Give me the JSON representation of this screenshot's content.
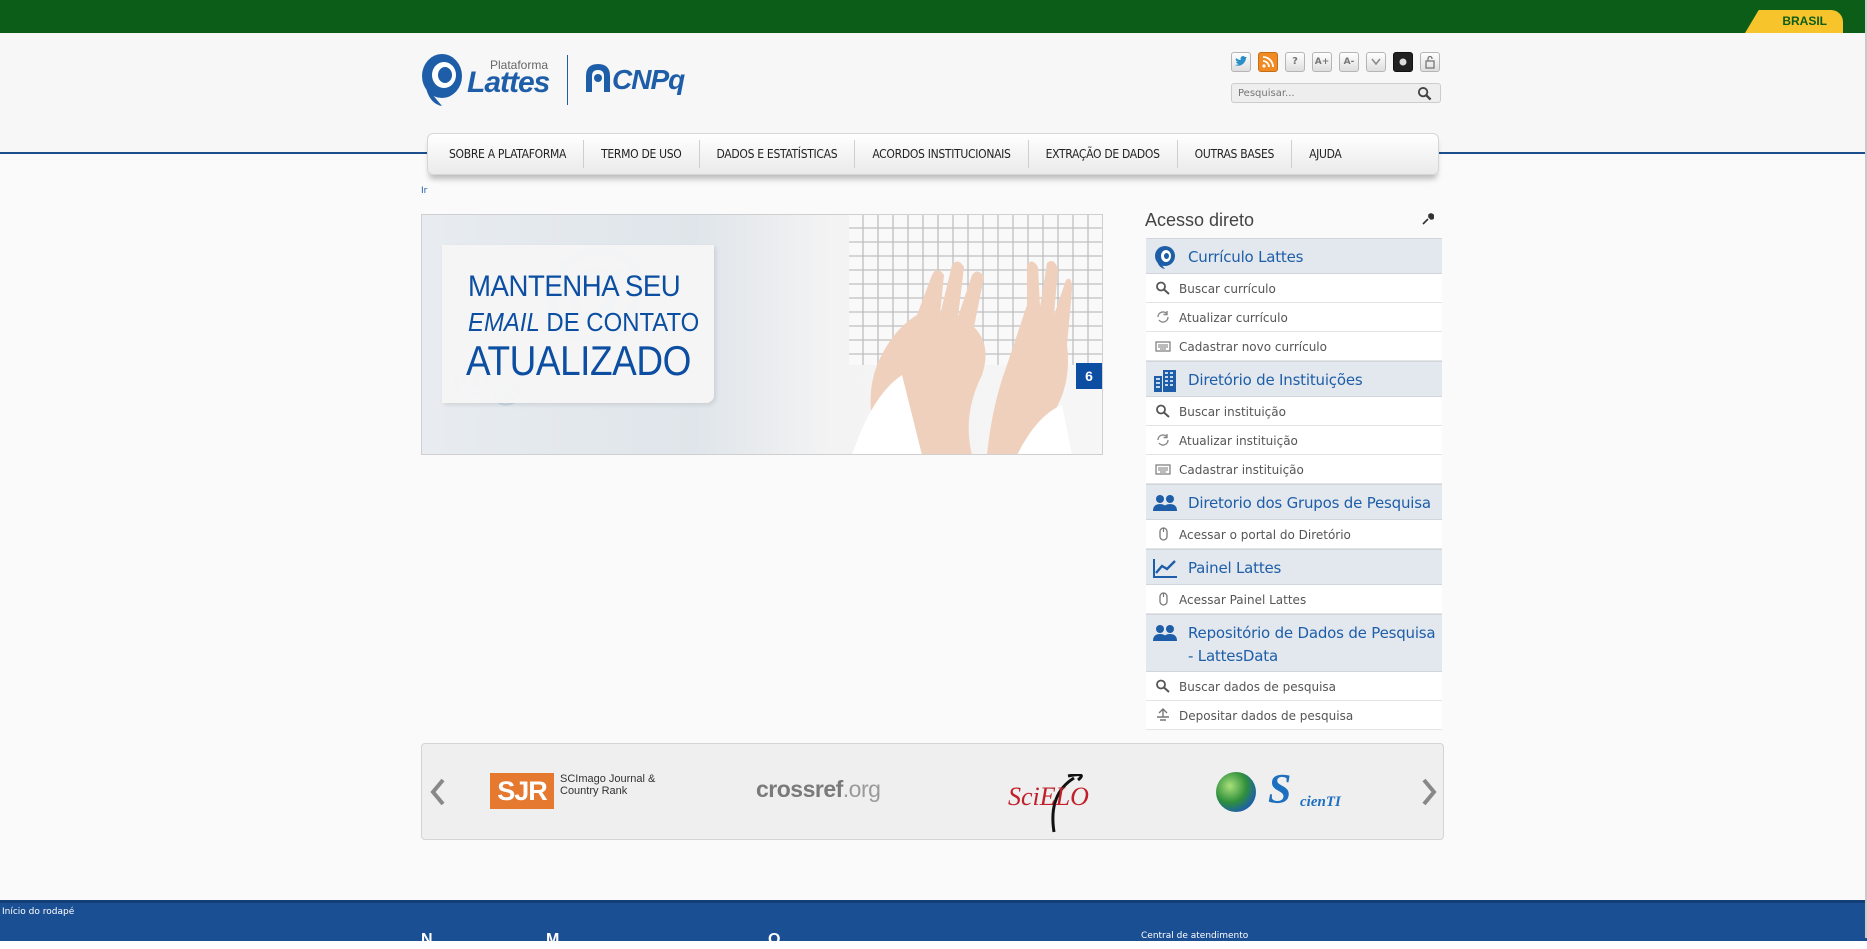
{
  "gov_bar": {
    "label": "BRASIL",
    "color": "#0b5d17",
    "accent": "#f7c52b"
  },
  "logo": {
    "plataforma": "Plataforma",
    "lattes": "Lattes",
    "cnpq": "CNPq"
  },
  "toolbar": {
    "icons": [
      "twitter-icon",
      "rss-icon",
      "help-icon",
      "font-increase-icon",
      "font-decrease-icon",
      "dropdown-icon",
      "contrast-icon",
      "lock-icon"
    ],
    "help": "?",
    "font_increase": "A+",
    "font_decrease": "A-",
    "search_placeholder": "Pesquisar..."
  },
  "nav": {
    "items": [
      "SOBRE A PLATAFORMA",
      "TERMO DE USO",
      "DADOS E ESTATÍSTICAS",
      "ACORDOS INSTITUCIONAIS",
      "EXTRAÇÃO DE DADOS",
      "OUTRAS BASES",
      "AJUDA"
    ]
  },
  "ir_link": "Ir",
  "banner": {
    "line1": "MANTENHA SEU",
    "line2_italic": "EMAIL",
    "line2_rest": " DE CONTATO",
    "line3": "ATUALIZADO",
    "counter": "6"
  },
  "sidebar": {
    "title": "Acesso direto",
    "sections": [
      {
        "title": "Currículo Lattes",
        "icon": "lattes-icon",
        "items": [
          {
            "label": "Buscar currículo",
            "icon": "search-icon"
          },
          {
            "label": "Atualizar currículo",
            "icon": "refresh-icon"
          },
          {
            "label": "Cadastrar novo currículo",
            "icon": "keyboard-icon"
          }
        ]
      },
      {
        "title": "Diretório de Instituições",
        "icon": "building-icon",
        "items": [
          {
            "label": "Buscar instituição",
            "icon": "search-icon"
          },
          {
            "label": "Atualizar instituição",
            "icon": "refresh-icon"
          },
          {
            "label": "Cadastrar instituição",
            "icon": "keyboard-icon"
          }
        ]
      },
      {
        "title": "Diretorio dos Grupos de Pesquisa",
        "icon": "group-icon",
        "items": [
          {
            "label": "Acessar o portal do Diretório",
            "icon": "mouse-icon"
          }
        ]
      },
      {
        "title": "Painel Lattes",
        "icon": "line-chart-icon",
        "items": [
          {
            "label": "Acessar Painel Lattes",
            "icon": "mouse-icon"
          }
        ]
      },
      {
        "title": "Repositório de Dados de Pesquisa - LattesData",
        "icon": "group-icon",
        "items": [
          {
            "label": "Buscar dados de pesquisa",
            "icon": "search-icon"
          },
          {
            "label": "Depositar dados de pesquisa",
            "icon": "upload-icon"
          }
        ]
      }
    ]
  },
  "partners": {
    "sjr_logo": "SJR",
    "sjr_text": "SCImago Journal & Country Rank",
    "crossref_main": "crossref",
    "crossref_suffix": ".org",
    "scielo": "SciELO",
    "scienti_big": "S",
    "scienti_small": "cienTI"
  },
  "footer": {
    "start": "Início do rodapé",
    "h1": "N",
    "h2": "M",
    "h3": "O",
    "central": "Central de atendimento"
  }
}
